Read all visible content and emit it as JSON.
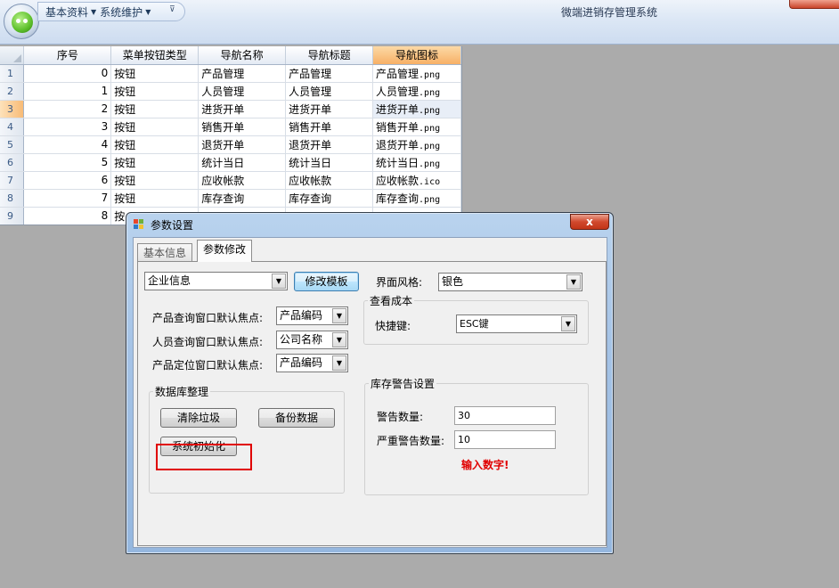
{
  "app": {
    "title": "微端进销存管理系统",
    "quick_access": [
      {
        "label": "基本资料",
        "icon": "dropdown-arrow"
      },
      {
        "label": "系统维护",
        "icon": "dropdown-arrow"
      }
    ]
  },
  "grid": {
    "columns": [
      "序号",
      "菜单按钮类型",
      "导航名称",
      "导航标题",
      "导航图标"
    ],
    "rows": [
      {
        "rownum": "1",
        "id": "0",
        "type": "按钮",
        "name": "产品管理",
        "title": "产品管理",
        "icon_name": "产品管理",
        "icon_ext": ".png"
      },
      {
        "rownum": "2",
        "id": "1",
        "type": "按钮",
        "name": "人员管理",
        "title": "人员管理",
        "icon_name": "人员管理",
        "icon_ext": ".png"
      },
      {
        "rownum": "3",
        "id": "2",
        "type": "按钮",
        "name": "进货开单",
        "title": "进货开单",
        "icon_name": "进货开单",
        "icon_ext": ".png"
      },
      {
        "rownum": "4",
        "id": "3",
        "type": "按钮",
        "name": "销售开单",
        "title": "销售开单",
        "icon_name": "销售开单",
        "icon_ext": ".png"
      },
      {
        "rownum": "5",
        "id": "4",
        "type": "按钮",
        "name": "退货开单",
        "title": "退货开单",
        "icon_name": "退货开单",
        "icon_ext": ".png"
      },
      {
        "rownum": "6",
        "id": "5",
        "type": "按钮",
        "name": "统计当日",
        "title": "统计当日",
        "icon_name": "统计当日",
        "icon_ext": ".png"
      },
      {
        "rownum": "7",
        "id": "6",
        "type": "按钮",
        "name": "应收帐款",
        "title": "应收帐款",
        "icon_name": "应收帐款",
        "icon_ext": ".ico"
      },
      {
        "rownum": "8",
        "id": "7",
        "type": "按钮",
        "name": "库存查询",
        "title": "库存查询",
        "icon_name": "库存查询",
        "icon_ext": ".png"
      },
      {
        "rownum": "9",
        "id": "8",
        "type": "按",
        "name": "",
        "title": "",
        "icon_name": "",
        "icon_ext": ""
      }
    ]
  },
  "dialog": {
    "title": "参数设置",
    "close_glyph": "x",
    "tabs": [
      "基本信息",
      "参数修改"
    ],
    "company_combo": "企业信息",
    "edit_template_button": "修改模板",
    "theme_label": "界面风格:",
    "theme_value": "银色",
    "focus_rows": [
      {
        "label": "产品查询窗口默认焦点:",
        "value": "产品编码"
      },
      {
        "label": "人员查询窗口默认焦点:",
        "value": "公司名称"
      },
      {
        "label": "产品定位窗口默认焦点:",
        "value": "产品编码"
      }
    ],
    "cost_group": {
      "title": "查看成本",
      "shortcut_label": "快捷键:",
      "shortcut_value": "ESC键"
    },
    "db_group": {
      "title": "数据库整理",
      "clear_button": "清除垃圾",
      "backup_button": "备份数据",
      "init_button": "系统初始化"
    },
    "stock_group": {
      "title": "库存警告设置",
      "warn_label": "警告数量:",
      "warn_value": "30",
      "severe_label": "严重警告数量:",
      "severe_value": "10",
      "hint": "输入数字!"
    }
  }
}
